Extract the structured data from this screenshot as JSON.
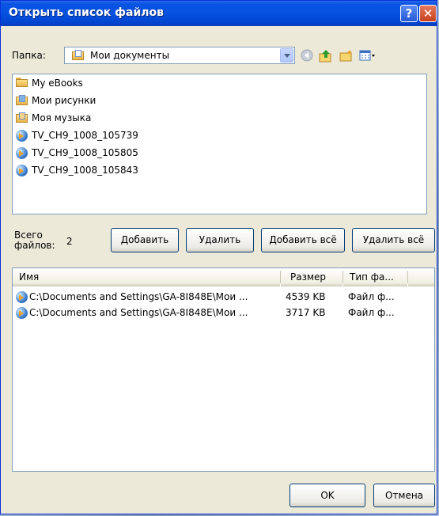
{
  "window": {
    "title": "Открыть список файлов",
    "help_label": "?",
    "close_label": "✕"
  },
  "toolbar": {
    "folder_label": "Папка:",
    "folder_value": "Мои документы"
  },
  "files": [
    {
      "name": "My eBooks",
      "icon": "folder-icon"
    },
    {
      "name": "Мои рисунки",
      "icon": "pictures-folder-icon"
    },
    {
      "name": "Моя музыка",
      "icon": "music-folder-icon"
    },
    {
      "name": "TV_CH9_1008_105739",
      "icon": "video-file-icon"
    },
    {
      "name": "TV_CH9_1008_105805",
      "icon": "video-file-icon"
    },
    {
      "name": "TV_CH9_1008_105843",
      "icon": "video-file-icon"
    }
  ],
  "summary": {
    "total_label_1": "Всего",
    "total_label_2": "файлов:",
    "total_count": "2"
  },
  "actions": {
    "add": "Добавить",
    "remove": "Удалить",
    "add_all": "Добавить всё",
    "remove_all": "Удалить всё"
  },
  "list": {
    "columns": {
      "name": "Имя",
      "size": "Размер",
      "type": "Тип фа..."
    },
    "rows": [
      {
        "name": "C:\\Documents and Settings\\GA-8I848E\\Мои ...",
        "size": "4539 KB",
        "type": "Файл ф..."
      },
      {
        "name": "C:\\Documents and Settings\\GA-8I848E\\Мои ...",
        "size": "3717 KB",
        "type": "Файл ф..."
      }
    ]
  },
  "footer": {
    "ok": "OK",
    "cancel": "Отмена"
  }
}
